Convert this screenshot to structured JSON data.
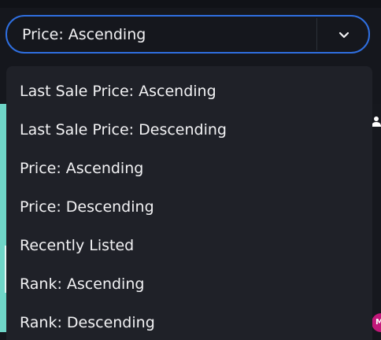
{
  "sort_select": {
    "selected": "Price: Ascending",
    "accent_color": "#2f6fe0",
    "chevron_icon": "chevron-down-icon"
  },
  "sort_menu": {
    "options": [
      "Last Sale Price: Ascending",
      "Last Sale Price: Descending",
      "Price: Ascending",
      "Price: Descending",
      "Recently Listed",
      "Rank: Ascending",
      "Rank: Descending"
    ]
  },
  "background": {
    "avatar_initial": "M",
    "user_icon": "user-icon"
  }
}
